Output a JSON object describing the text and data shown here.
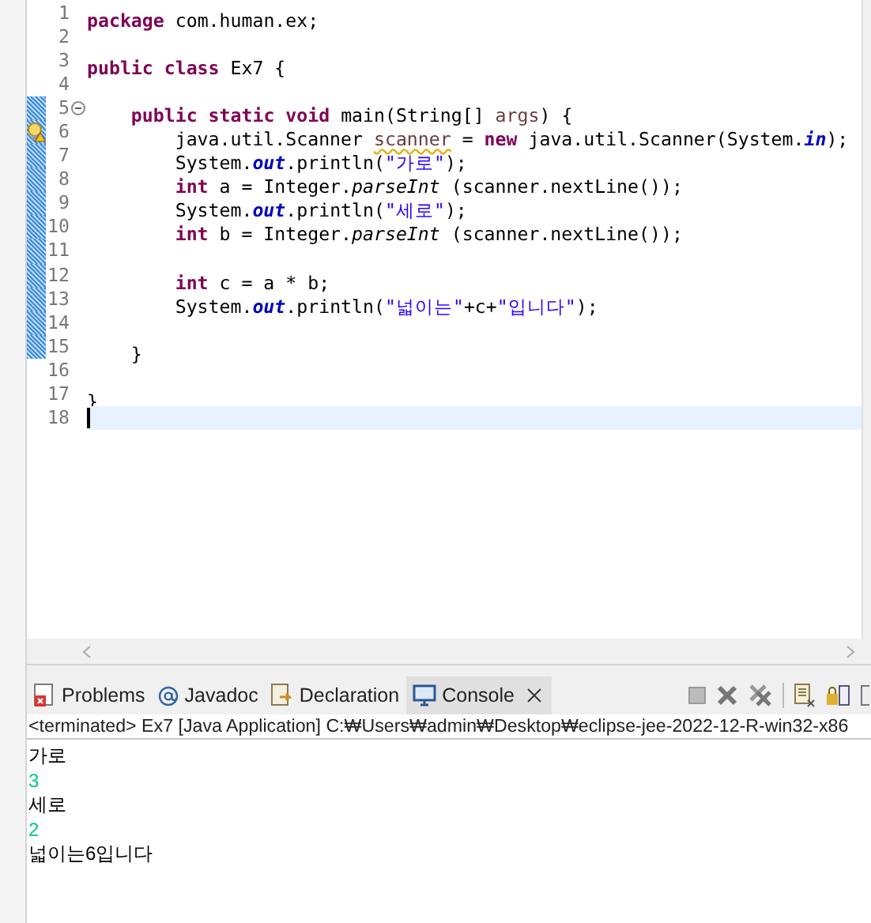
{
  "editor": {
    "lines": [
      {
        "number": "1",
        "kind": "plain",
        "changed": false,
        "current": false,
        "tokens": [
          {
            "kind": "kw",
            "text": "package"
          },
          {
            "kind": "plain",
            "text": " com.human.ex;"
          }
        ]
      },
      {
        "number": "2",
        "kind": "plain",
        "changed": false,
        "current": false
      },
      {
        "number": "3",
        "kind": "plain",
        "changed": false,
        "current": false,
        "tokens": [
          {
            "kind": "kw",
            "text": "public"
          },
          {
            "kind": "kw",
            "text": " class"
          },
          {
            "kind": "plain",
            "text": " Ex7 {"
          }
        ]
      },
      {
        "number": "4",
        "kind": "plain",
        "changed": false,
        "current": false
      },
      {
        "number": "5",
        "kind": "fold",
        "changed": true,
        "current": false,
        "tokens": [
          {
            "kind": "kw",
            "text": "    public"
          },
          {
            "kind": "kw",
            "text": " static"
          },
          {
            "kind": "kw",
            "text": " void"
          },
          {
            "kind": "plain",
            "text": " main(String[]"
          },
          {
            "kind": "param",
            "text": " args"
          },
          {
            "kind": "plain",
            "text": ") {"
          }
        ]
      },
      {
        "number": "6",
        "kind": "warning",
        "changed": true,
        "current": false,
        "tokens": [
          {
            "kind": "plain",
            "text": "        java.util.Scanner "
          },
          {
            "kind": "warn",
            "text": "scanner"
          },
          {
            "kind": "plain",
            "text": " ="
          },
          {
            "kind": "kw",
            "text": " new"
          },
          {
            "kind": "plain",
            "text": " java.util.Scanner(System."
          },
          {
            "kind": "field",
            "text": "in"
          },
          {
            "kind": "plain",
            "text": ");"
          }
        ]
      },
      {
        "number": "7",
        "kind": "plain",
        "changed": true,
        "current": false,
        "tokens": [
          {
            "kind": "plain",
            "text": "        System."
          },
          {
            "kind": "field",
            "text": "out"
          },
          {
            "kind": "plain",
            "text": ".println("
          },
          {
            "kind": "str",
            "text": "\"가로\""
          },
          {
            "kind": "plain",
            "text": ");"
          }
        ]
      },
      {
        "number": "8",
        "kind": "plain",
        "changed": true,
        "current": false,
        "tokens": [
          {
            "kind": "kw",
            "text": "        int"
          },
          {
            "kind": "plain",
            "text": " a = Integer."
          },
          {
            "kind": "method",
            "text": "parseInt"
          },
          {
            "kind": "plain",
            "text": " (scanner.nextLine());"
          }
        ]
      },
      {
        "number": "9",
        "kind": "plain",
        "changed": true,
        "current": false,
        "tokens": [
          {
            "kind": "plain",
            "text": "        System."
          },
          {
            "kind": "field",
            "text": "out"
          },
          {
            "kind": "plain",
            "text": ".println("
          },
          {
            "kind": "str",
            "text": "\"세로\""
          },
          {
            "kind": "plain",
            "text": ");"
          }
        ]
      },
      {
        "number": "10",
        "kind": "plain",
        "changed": true,
        "current": false,
        "tokens": [
          {
            "kind": "kw",
            "text": "        int"
          },
          {
            "kind": "plain",
            "text": " b = Integer."
          },
          {
            "kind": "method",
            "text": "parseInt"
          },
          {
            "kind": "plain",
            "text": " (scanner.nextLine());"
          }
        ]
      },
      {
        "number": "11",
        "kind": "plain",
        "changed": true,
        "current": false
      },
      {
        "number": "12",
        "kind": "plain",
        "changed": true,
        "current": false,
        "tokens": [
          {
            "kind": "kw",
            "text": "        int"
          },
          {
            "kind": "plain",
            "text": " c = a * b;"
          }
        ]
      },
      {
        "number": "13",
        "kind": "plain",
        "changed": true,
        "current": false,
        "tokens": [
          {
            "kind": "plain",
            "text": "        System."
          },
          {
            "kind": "field",
            "text": "out"
          },
          {
            "kind": "plain",
            "text": ".println("
          },
          {
            "kind": "str",
            "text": "\"넓이는\""
          },
          {
            "kind": "plain",
            "text": "+c+"
          },
          {
            "kind": "str",
            "text": "\"입니다\""
          },
          {
            "kind": "plain",
            "text": ");"
          }
        ]
      },
      {
        "number": "14",
        "kind": "plain",
        "changed": true,
        "current": false
      },
      {
        "number": "15",
        "kind": "plain",
        "changed": true,
        "current": false,
        "tokens": [
          {
            "kind": "plain",
            "text": "    }"
          }
        ]
      },
      {
        "number": "16",
        "kind": "plain",
        "changed": false,
        "current": false
      },
      {
        "number": "17",
        "kind": "plain",
        "changed": false,
        "current": false,
        "tokens": [
          {
            "kind": "plain",
            "text": "}"
          }
        ]
      },
      {
        "number": "18",
        "kind": "plain",
        "changed": false,
        "current": true
      }
    ]
  },
  "panel": {
    "tabs": [
      {
        "label": "Problems",
        "selected": false
      },
      {
        "label": "Javadoc",
        "selected": false
      },
      {
        "label": "Declaration",
        "selected": false
      },
      {
        "label": "Console",
        "selected": true
      }
    ],
    "status": "<terminated> Ex7 [Java Application] C:₩Users₩admin₩Desktop₩eclipse-jee-2022-12-R-win32-x86",
    "output": [
      {
        "kind": "output",
        "text": "가로"
      },
      {
        "kind": "input",
        "text": "3"
      },
      {
        "kind": "output",
        "text": "세로"
      },
      {
        "kind": "input",
        "text": "2"
      },
      {
        "kind": "output",
        "text": "넓이는6입니다"
      }
    ]
  }
}
